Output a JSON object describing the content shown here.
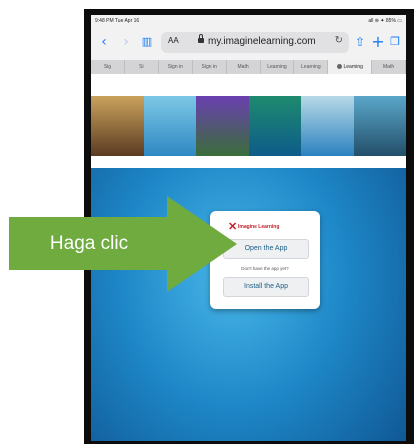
{
  "status_bar": {
    "left": "9:48 PM  Tue Apr 16",
    "right": "all ⊜ ✦ 85% ▭"
  },
  "browser": {
    "text_size_label": "AA",
    "url": "my.imaginelearning.com",
    "icons": {
      "back": "chevron-left-icon",
      "forward": "chevron-right-icon",
      "bookmarks": "book-icon",
      "reload": "reload-icon",
      "share": "share-icon",
      "new_tab": "plus-icon",
      "tabs": "tabs-icon"
    },
    "tabs": [
      "Sig",
      "Si",
      "Sign in",
      "Sign in",
      "Math",
      "Learning",
      "Learning",
      "Learning",
      "Math"
    ],
    "active_tab_index": 7
  },
  "card": {
    "logo_text": "Imagine Learning",
    "open_app_label": "Open the App",
    "question": "Don't have the app yet?",
    "install_app_label": "Install the App"
  },
  "annotation": {
    "text": "Haga clic",
    "color": "#6fab3f"
  }
}
